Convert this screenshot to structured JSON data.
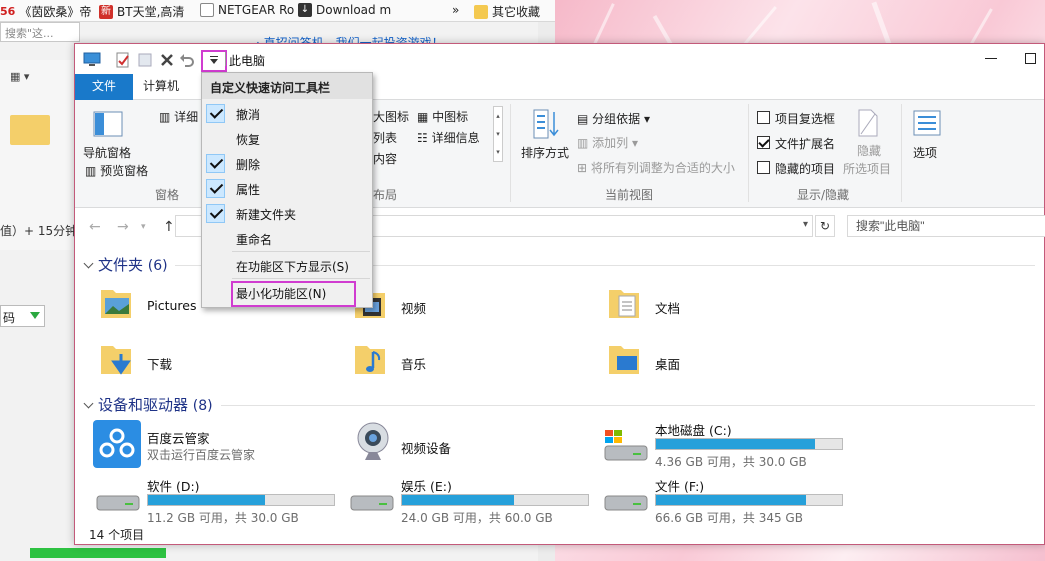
{
  "browser": {
    "bookmarks": [
      {
        "icon": "bookmark-icon",
        "label": "《茵欧桑》帝"
      },
      {
        "icon": "new-badge-icon",
        "badge": "新",
        "label": "BT天堂,高清"
      },
      {
        "icon": "page-icon",
        "label": "NETGEAR Ro"
      },
      {
        "icon": "download-icon",
        "label": "Download m"
      },
      {
        "icon": "overflow-icon",
        "label": "»"
      },
      {
        "icon": "folder-icon",
        "label": "其它收藏"
      }
    ],
    "bookmark_prefix": "56",
    "search_fragment": "搜索\"这...",
    "ad_text": "· 直招问答机，我们一起投资游戏！",
    "fragment_text": "值）+ 15分钟",
    "combo_value": "码"
  },
  "explorer": {
    "title": "此电脑",
    "tabs": {
      "file": "文件",
      "computer": "计算机"
    },
    "ribbon": {
      "nav_pane": "导航窗格",
      "preview_pane": "预览窗格",
      "details_pane": "详细",
      "group_panes": "窗格",
      "layout_items": [
        "大图标",
        "中图标",
        "列表",
        "详细信息",
        "内容"
      ],
      "group_layout": "布局",
      "sort_by": "排序方式",
      "group_by": "分组依据",
      "add_column": "添加列",
      "fit_columns": "将所有列调整为合适的大小",
      "group_view": "当前视图",
      "item_checkboxes": "项目复选框",
      "file_extensions": "文件扩展名",
      "hidden_items": "隐藏的项目",
      "hide": "隐藏",
      "hide_selected": "所选项目",
      "group_show_hide": "显示/隐藏",
      "options": "选项"
    },
    "search_placeholder": "搜索\"此电脑\"",
    "refresh": "↻",
    "folders_header": "文件夹",
    "folders_count": "(6)",
    "folders": [
      "Pictures",
      "视频",
      "文档",
      "下载",
      "音乐",
      "桌面"
    ],
    "devices_header": "设备和驱动器",
    "devices_count": "(8)",
    "devices": [
      {
        "name": "百度云管家",
        "sub": "双击运行百度云管家"
      },
      {
        "name": "视频设备",
        "sub": ""
      },
      {
        "name": "本地磁盘 (C:)",
        "sub": "4.36 GB 可用，共 30.0 GB",
        "used_fraction": 0.855
      },
      {
        "name": "软件 (D:)",
        "sub": "11.2 GB 可用，共 30.0 GB",
        "used_fraction": 0.627
      },
      {
        "name": "娱乐 (E:)",
        "sub": "24.0 GB 可用，共 60.0 GB",
        "used_fraction": 0.6
      },
      {
        "name": "文件 (F:)",
        "sub": "66.6 GB 可用，共 345 GB",
        "used_fraction": 0.807
      }
    ],
    "status": "14 个项目"
  },
  "qat_menu": {
    "title": "自定义快速访问工具栏",
    "items": [
      {
        "label": "撤消",
        "checked": true
      },
      {
        "label": "恢复",
        "checked": false
      },
      {
        "label": "删除",
        "checked": true
      },
      {
        "label": "属性",
        "checked": true
      },
      {
        "label": "新建文件夹",
        "checked": true
      },
      {
        "label": "重命名",
        "checked": false
      }
    ],
    "show_below": "在功能区下方显示(S)",
    "minimize": "最小化功能区(N)"
  },
  "colors": {
    "file_tab": "#1979ca",
    "highlight": "#d03cd0",
    "drive_bar": "#26a0da",
    "section_header": "#1e3287"
  }
}
